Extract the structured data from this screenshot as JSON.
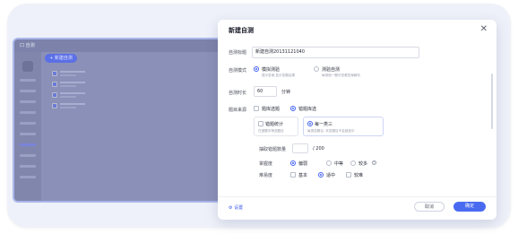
{
  "background_app": {
    "logo_text": "口 自测",
    "new_button_label": "+ 新建自测"
  },
  "modal": {
    "title": "新建自测",
    "close_icon": "close-icon",
    "fields": {
      "title_label": "自测标题",
      "title_value": "新建自测20131121040",
      "mode_label": "自测模式",
      "mode_options": [
        {
          "label": "模拟测验",
          "desc": "提示答案,显示答题结果",
          "selected": true
        },
        {
          "label": "测验自测",
          "desc": "每测验一题可查看答案解析",
          "selected": false
        }
      ],
      "duration_label": "自测时长",
      "duration_value": "60",
      "duration_unit": "分钟",
      "source_label": "题目来源",
      "source_options": [
        {
          "label": "题库选题",
          "checked": false
        },
        {
          "label": "错题库选",
          "checked": true
        }
      ],
      "range_options": [
        {
          "label": "错题统计",
          "desc": "在错题中筛选题目",
          "selected": false
        },
        {
          "label": "每一类三",
          "desc": "每类选题目, 未答题目不会被选中",
          "selected": true
        }
      ],
      "count_label": "抽取错题数量",
      "count_value": "",
      "count_total": "/ 200",
      "difficulty_label": "掌握度",
      "difficulty_options": [
        {
          "label": "偏弱",
          "selected": true
        },
        {
          "label": "中等",
          "selected": false
        },
        {
          "label": "较多",
          "selected": false
        }
      ],
      "accuracy_label": "难易度",
      "accuracy_options": [
        {
          "label": "基本",
          "checked": false
        },
        {
          "label": "适中",
          "checked": true
        },
        {
          "label": "较难",
          "checked": false
        }
      ]
    },
    "footer": {
      "settings_label": "⚙ 设置",
      "cancel_label": "取消",
      "ok_label": "确定"
    }
  },
  "colors": {
    "accent": "#4a6bf0",
    "frame_bg": "#eef1f9",
    "overlay": "#8a90b8"
  }
}
